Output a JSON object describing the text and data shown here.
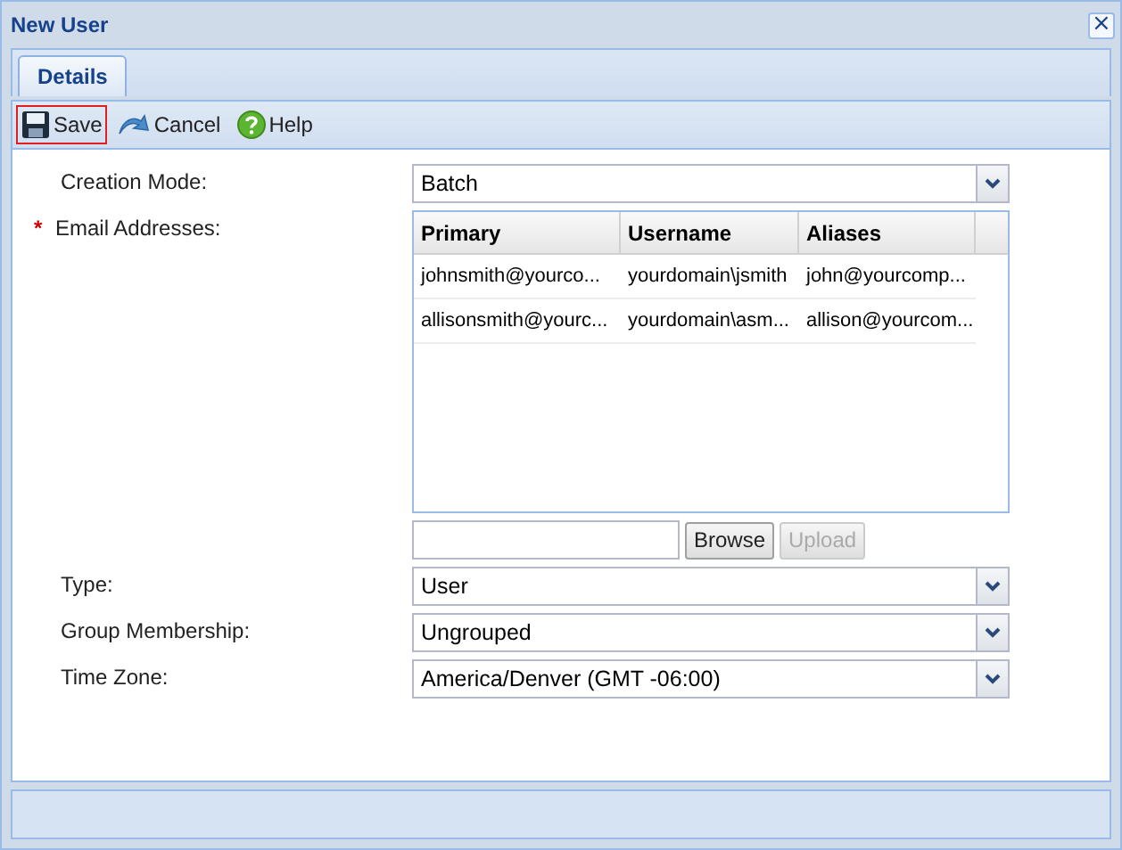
{
  "window": {
    "title": "New User",
    "close": "×"
  },
  "tabs": [
    {
      "label": "Details",
      "selected": true
    }
  ],
  "toolbar": [
    {
      "kind": "save",
      "label": "Save",
      "highlighted": true
    },
    {
      "kind": "cancel",
      "label": "Cancel",
      "highlighted": false
    },
    {
      "kind": "help",
      "label": "Help",
      "highlighted": false
    }
  ],
  "form": {
    "creation_mode": {
      "label": "Creation Mode:",
      "value": "Batch",
      "required": false
    },
    "email": {
      "label": "Email Addresses:",
      "required": true,
      "required_mark": "*",
      "columns": [
        "Primary",
        "Username",
        "Aliases"
      ],
      "rows": [
        [
          "johnsmith@yourco...",
          "yourdomain\\jsmith",
          "john@yourcomp..."
        ],
        [
          "allisonsmith@yourc...",
          "yourdomain\\asm...",
          "allison@yourcom..."
        ]
      ]
    },
    "upload": {
      "buttons": [
        {
          "label": "Browse",
          "disabled": false
        },
        {
          "label": "Upload",
          "disabled": true
        }
      ]
    },
    "selects": [
      {
        "label": "Type:",
        "value": "User"
      },
      {
        "label": "Group Membership:",
        "value": "Ungrouped"
      },
      {
        "label": "Time Zone:",
        "value": "America/Denver (GMT -06:00)"
      }
    ]
  }
}
